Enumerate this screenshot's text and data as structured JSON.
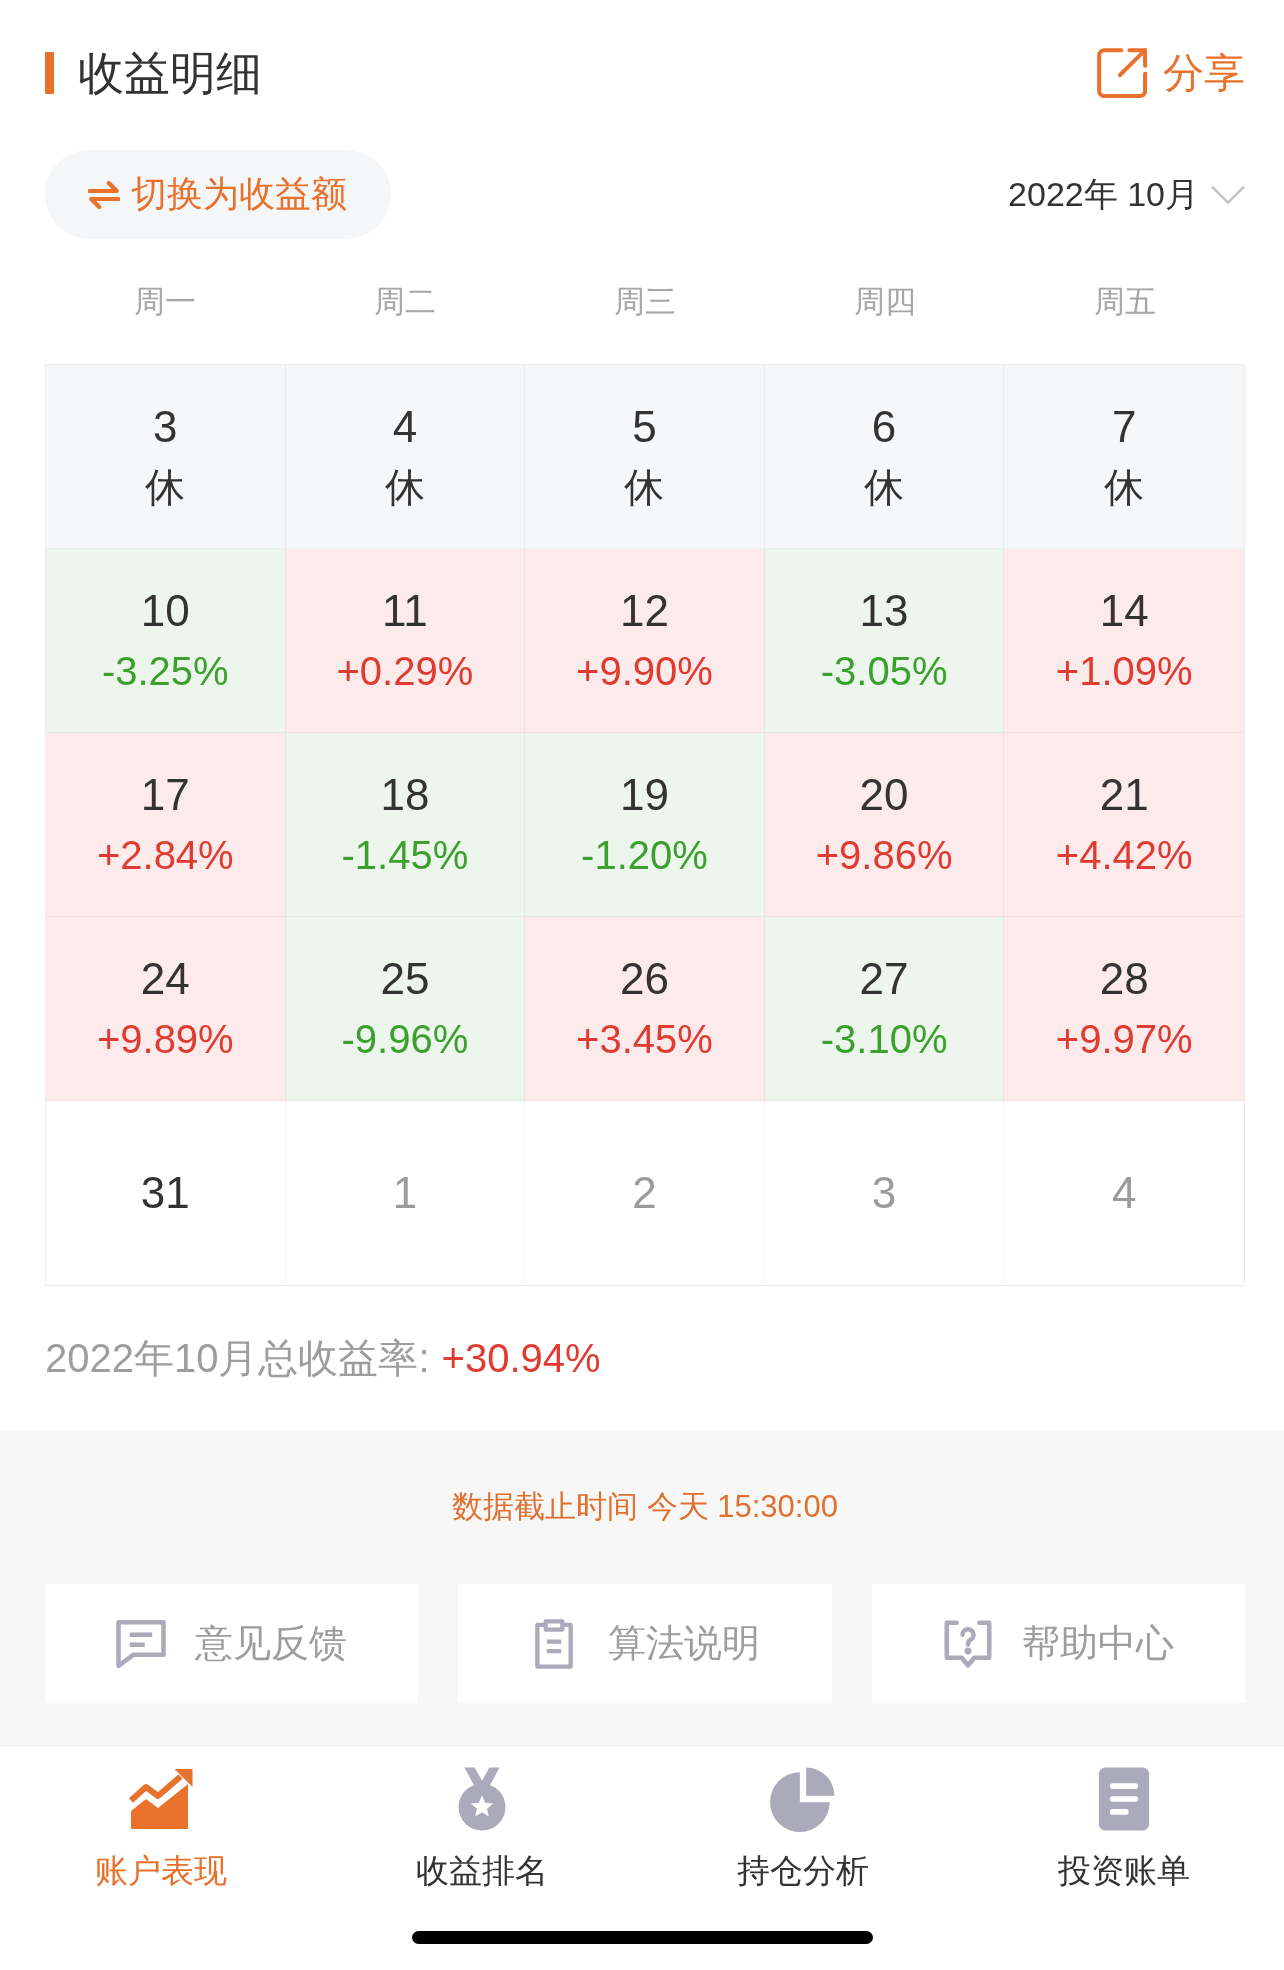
{
  "header": {
    "title": "收益明细",
    "share": "分享"
  },
  "toggle": {
    "label": "切换为收益额"
  },
  "month_picker": {
    "label": "2022年 10月"
  },
  "weekdays": [
    "周一",
    "周二",
    "周三",
    "周四",
    "周五"
  ],
  "calendar": {
    "weeks": [
      [
        {
          "date": "3",
          "kind": "holiday",
          "note": "休"
        },
        {
          "date": "4",
          "kind": "holiday",
          "note": "休"
        },
        {
          "date": "5",
          "kind": "holiday",
          "note": "休"
        },
        {
          "date": "6",
          "kind": "holiday",
          "note": "休"
        },
        {
          "date": "7",
          "kind": "holiday",
          "note": "休"
        }
      ],
      [
        {
          "date": "10",
          "kind": "loss",
          "change": "-3.25%"
        },
        {
          "date": "11",
          "kind": "gain",
          "change": "+0.29%"
        },
        {
          "date": "12",
          "kind": "gain",
          "change": "+9.90%"
        },
        {
          "date": "13",
          "kind": "loss",
          "change": "-3.05%"
        },
        {
          "date": "14",
          "kind": "gain",
          "change": "+1.09%"
        }
      ],
      [
        {
          "date": "17",
          "kind": "gain",
          "change": "+2.84%"
        },
        {
          "date": "18",
          "kind": "loss",
          "change": "-1.45%"
        },
        {
          "date": "19",
          "kind": "loss",
          "change": "-1.20%"
        },
        {
          "date": "20",
          "kind": "gain",
          "change": "+9.86%"
        },
        {
          "date": "21",
          "kind": "gain",
          "change": "+4.42%"
        }
      ],
      [
        {
          "date": "24",
          "kind": "gain",
          "change": "+9.89%"
        },
        {
          "date": "25",
          "kind": "loss",
          "change": "-9.96%"
        },
        {
          "date": "26",
          "kind": "gain",
          "change": "+3.45%"
        },
        {
          "date": "27",
          "kind": "loss",
          "change": "-3.10%"
        },
        {
          "date": "28",
          "kind": "gain",
          "change": "+9.97%"
        }
      ],
      [
        {
          "date": "31",
          "kind": "no_data"
        },
        {
          "date": "1",
          "kind": "other_month"
        },
        {
          "date": "2",
          "kind": "other_month"
        },
        {
          "date": "3",
          "kind": "other_month"
        },
        {
          "date": "4",
          "kind": "other_month"
        }
      ]
    ]
  },
  "summary": {
    "label": "2022年10月总收益率:",
    "value": "+30.94%"
  },
  "data_time": "数据截止时间 今天 15:30:00",
  "footer_links": [
    "意见反馈",
    "算法说明",
    "帮助中心"
  ],
  "tabs": [
    {
      "label": "账户表现",
      "selected": true
    },
    {
      "label": "收益排名",
      "selected": false
    },
    {
      "label": "持仓分析",
      "selected": false
    },
    {
      "label": "投资账单",
      "selected": false
    }
  ]
}
